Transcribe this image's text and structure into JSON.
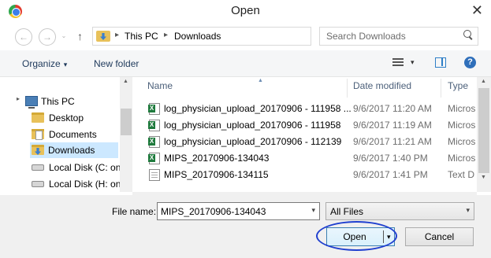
{
  "window": {
    "title": "Open",
    "close_glyph": "✕",
    "app_icon": "chrome-icon"
  },
  "nav": {
    "back_glyph": "←",
    "forward_glyph": "→",
    "up_glyph": "↑",
    "address_parts": [
      "This PC",
      "Downloads"
    ],
    "address_separator": "▸",
    "dropdown_glyph": "⌄",
    "refresh_glyph": "↻",
    "search_placeholder": "Search Downloads"
  },
  "toolbar": {
    "organize_label": "Organize",
    "organize_arrow": "▾",
    "new_folder_label": "New folder",
    "view_arrow": "▾",
    "help_label": "?"
  },
  "sidebar": {
    "expander": "▸",
    "items": [
      {
        "label": "This PC",
        "icon": "computer-icon"
      },
      {
        "label": "Desktop",
        "icon": "folder-icon"
      },
      {
        "label": "Documents",
        "icon": "documents-folder-icon"
      },
      {
        "label": "Downloads",
        "icon": "downloads-folder-icon",
        "selected": true
      },
      {
        "label": "Local Disk (C: on",
        "icon": "disk-icon"
      },
      {
        "label": "Local Disk (H: on",
        "icon": "disk-icon"
      }
    ]
  },
  "file_list": {
    "columns": [
      "Name",
      "Date modified",
      "Type"
    ],
    "sort_glyph": "▲",
    "rows": [
      {
        "name": "log_physician_upload_20170906 - 111958 ...",
        "date": "9/6/2017 11:20 AM",
        "type": "Micros",
        "icon": "excel-file-icon"
      },
      {
        "name": "log_physician_upload_20170906 - 111958",
        "date": "9/6/2017 11:19 AM",
        "type": "Micros",
        "icon": "excel-file-icon"
      },
      {
        "name": "log_physician_upload_20170906 - 112139",
        "date": "9/6/2017 11:21 AM",
        "type": "Micros",
        "icon": "excel-file-icon"
      },
      {
        "name": "MIPS_20170906-134043",
        "date": "9/6/2017 1:40 PM",
        "type": "Micros",
        "icon": "excel-file-icon"
      },
      {
        "name": "MIPS_20170906-134115",
        "date": "9/6/2017 1:41 PM",
        "type": "Text D",
        "icon": "text-file-icon"
      }
    ]
  },
  "scroll": {
    "up_glyph": "▲",
    "down_glyph": "▼"
  },
  "footer": {
    "file_name_label": "File name:",
    "file_name_value": "MIPS_20170906-134043",
    "filter_value": "All Files",
    "dropdown_glyph": "▾",
    "open_label": "Open",
    "cancel_label": "Cancel"
  }
}
